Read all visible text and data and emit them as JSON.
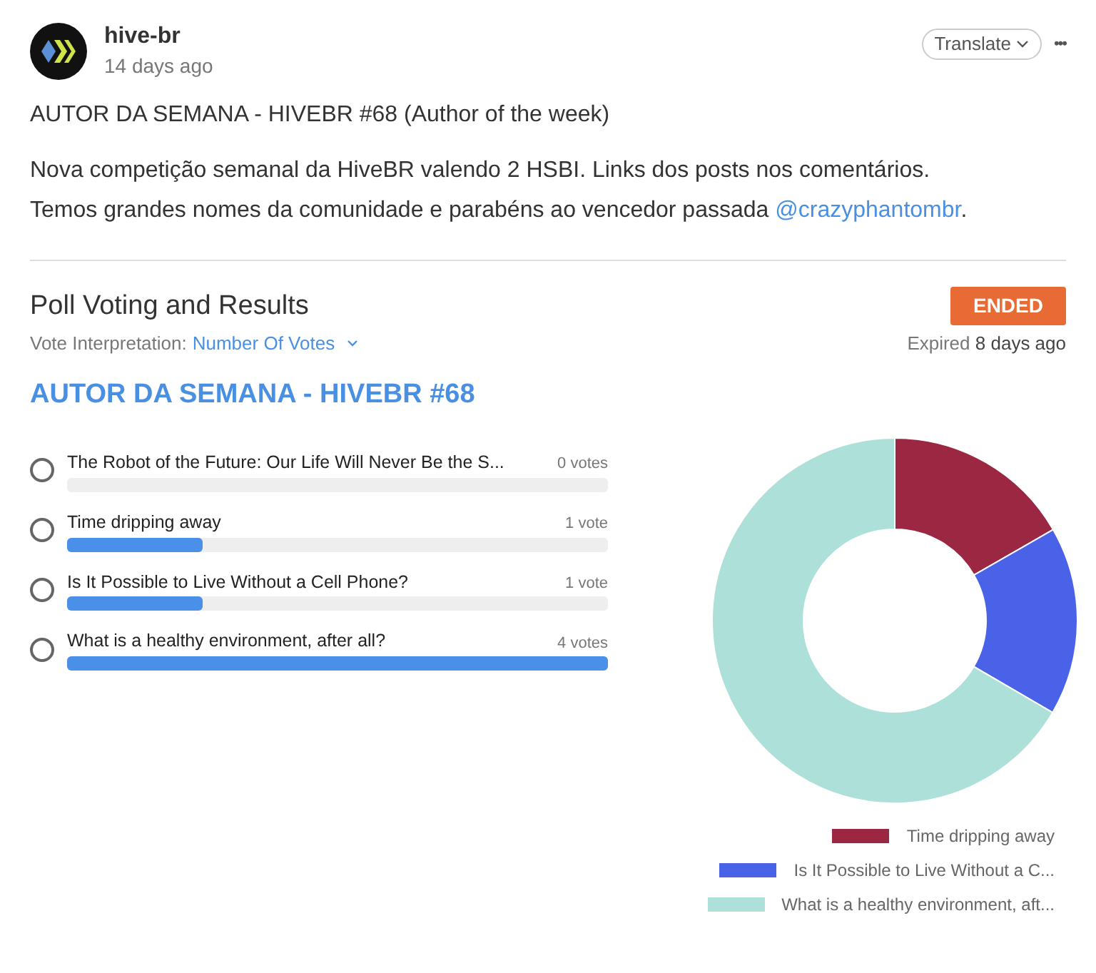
{
  "post": {
    "author": "hive-br",
    "time": "14 days ago",
    "translate": "Translate",
    "more": "•••",
    "title": "AUTOR DA SEMANA - HIVEBR #68 (Author of the week)",
    "body_1": "Nova competição semanal da HiveBR valendo 2 HSBI. Links dos posts nos comentários.",
    "body_2": "Temos grandes nomes da comunidade e parabéns ao vencedor passada ",
    "mention": "@crazyphantombr",
    "body_end": "."
  },
  "poll": {
    "heading": "Poll Voting and Results",
    "status": "ENDED",
    "interpretation_label": "Vote Interpretation:",
    "interpretation": "Number Of Votes",
    "expired_label": "Expired ",
    "expired": "8 days ago",
    "question": "AUTOR DA SEMANA - HIVEBR #68",
    "options": [
      {
        "label": "The Robot of the Future: Our Life Will Never Be the S...",
        "votes": "0 votes",
        "level": 0,
        "selected": false
      },
      {
        "label": "Time dripping away",
        "votes": "1 vote",
        "level": 0.25,
        "selected": false
      },
      {
        "label": "Is It Possible to Live Without a Cell Phone?",
        "votes": "1 vote",
        "level": 0.25,
        "selected": false
      },
      {
        "label": "What is a healthy environment, after all?",
        "votes": "4 votes",
        "level": 1,
        "selected": false
      }
    ],
    "chart_data": {
      "type": "donut",
      "legend": "bottom",
      "categories": [
        "Time dripping away",
        "Is It Possible to Live Without a C...",
        "What is a healthy environment, aft..."
      ],
      "values": [
        16.7,
        16.7,
        66.6
      ],
      "colors": [
        "#9b2742",
        "#4a62e8",
        "#ade0d8"
      ]
    }
  }
}
